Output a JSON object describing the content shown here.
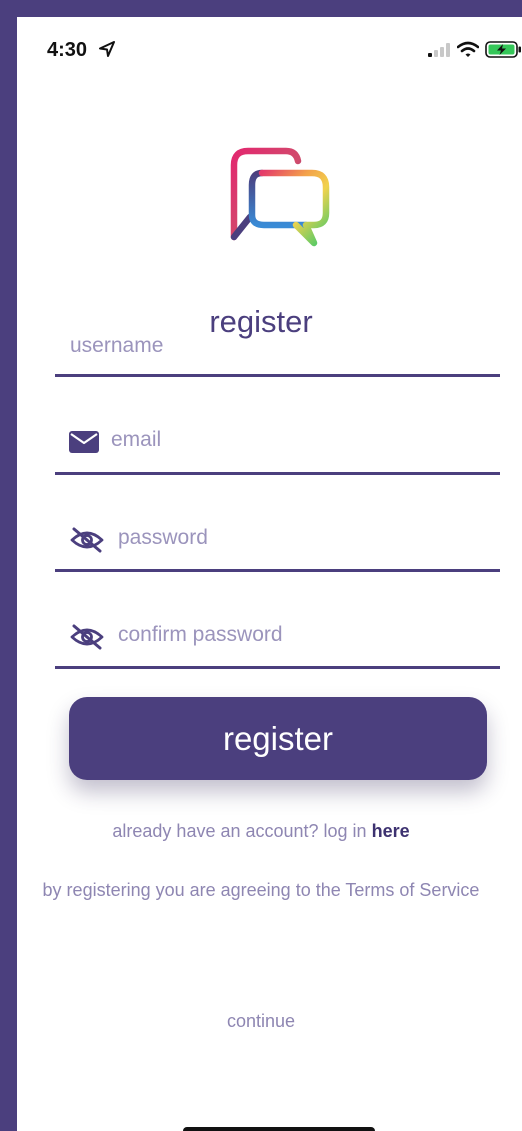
{
  "status_bar": {
    "time": "4:30",
    "location_icon": "location-arrow-icon",
    "signal_icon": "cellular-signal-icon",
    "wifi_icon": "wifi-icon",
    "battery_icon": "battery-charging-icon"
  },
  "logo": {
    "icon": "chat-bubbles-logo-icon"
  },
  "title": "register",
  "form": {
    "username_placeholder": "username",
    "email_placeholder": "email",
    "email_icon": "envelope-icon",
    "password_placeholder": "password",
    "password_icon": "eye-slash-icon",
    "confirm_password_placeholder": "confirm password",
    "confirm_password_icon": "eye-slash-icon"
  },
  "register_button_label": "register",
  "login_prompt": {
    "text": "already have an account? log in ",
    "link": "here"
  },
  "terms_text": "by registering you are agreeing to the Terms of Service",
  "continue_label": "continue",
  "colors": {
    "primary": "#4b3f7e",
    "placeholder": "#9b94bc",
    "secondary_text": "#8e86b2",
    "background": "#ffffff"
  }
}
